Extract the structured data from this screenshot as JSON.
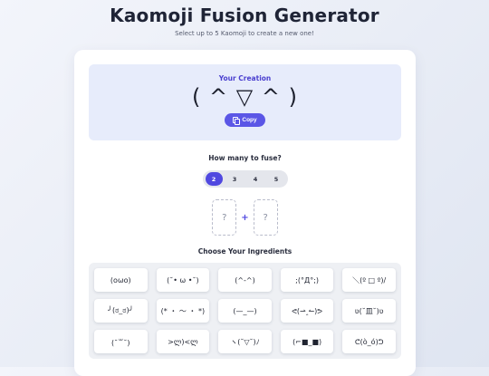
{
  "header": {
    "title": "Kaomoji Fusion Generator",
    "subtitle": "Select up to 5 Kaomoji to create a new one!"
  },
  "creation": {
    "title": "Your Creation",
    "kaomoji": "( ^ ▽ ^ )",
    "copy_label": "Copy"
  },
  "fuse": {
    "label": "How many to fuse?",
    "options": [
      "2",
      "3",
      "4",
      "5"
    ],
    "selected": "2"
  },
  "slots": {
    "slot1": "?",
    "plus": "+",
    "slot2": "?"
  },
  "ingredients": {
    "label": "Choose Your Ingredients",
    "items": [
      "(oωo)",
      "(˘• ω •˘)",
      "(^-^)",
      ";(°Д°;)",
      "＼(º □ º)/",
      "╯(ಠ_ಠ)╯",
      "(* ・ 〜 ・ *)",
      "(—_—)",
      "ᕙ(⇀‸↼)ᕗ",
      "ʋ(˘皿˘)ʋ",
      "(˘꒳˘)",
      ">ლ)<ლ",
      "ヽ(˘▽˘)ﾉ",
      "(⌐■_■)",
      "ᕦ(ò_ó)ᕤ"
    ]
  },
  "colors": {
    "accent": "#5048e0",
    "creation_bg": "#e7ecfb"
  }
}
